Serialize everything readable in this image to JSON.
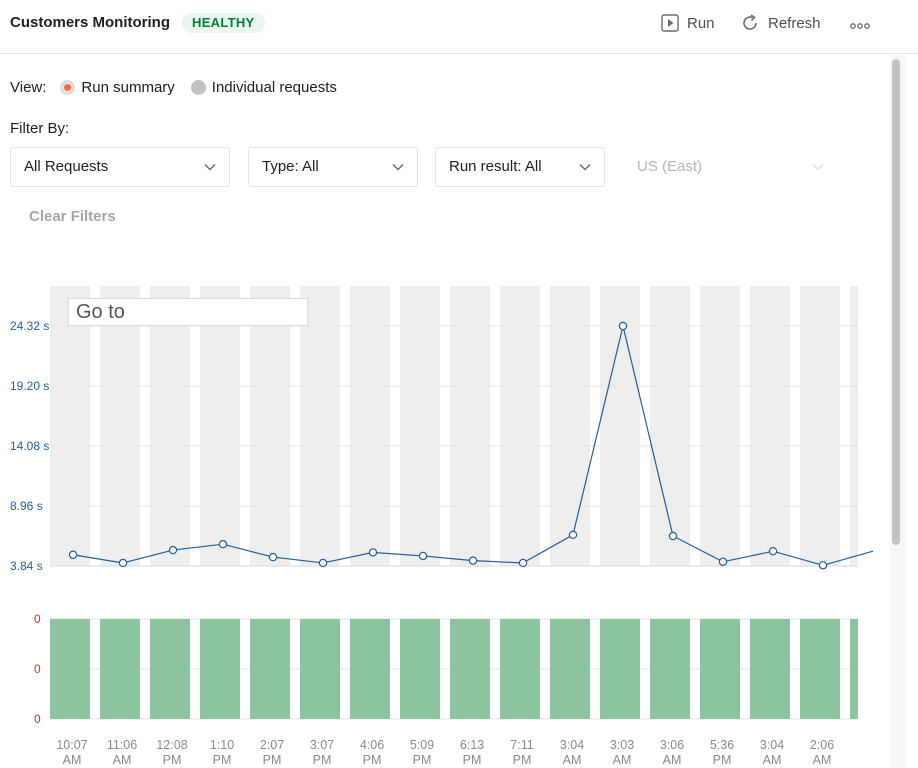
{
  "header": {
    "title": "Customers Monitoring",
    "status_badge": "HEALTHY",
    "run_label": "Run",
    "refresh_label": "Refresh"
  },
  "view": {
    "label": "View:",
    "options": [
      {
        "label": "Run summary",
        "selected": true
      },
      {
        "label": "Individual requests",
        "selected": false
      }
    ]
  },
  "filters": {
    "label": "Filter By:",
    "requests": "All Requests",
    "type": "Type: All",
    "run_result": "Run result: All",
    "region": "US (East)",
    "clear_label": "Clear Filters"
  },
  "goto_placeholder": "Go to",
  "colors": {
    "accent": "#ff6c37",
    "healthy": "#007f31",
    "line": "#1f5f99",
    "bar": "#8bc49e",
    "column_bg": "#eeeeee"
  },
  "chart_data": {
    "type": "line",
    "y_ticks": [
      "24.32 s",
      "19.20 s",
      "14.08 s",
      "8.96 s",
      "3.84 s"
    ],
    "ylim": [
      3.84,
      24.32
    ],
    "x_labels": [
      [
        "10:07",
        "AM"
      ],
      [
        "11:06",
        "AM"
      ],
      [
        "12:08",
        "PM"
      ],
      [
        "1:10",
        "PM"
      ],
      [
        "2:07",
        "PM"
      ],
      [
        "3:07",
        "PM"
      ],
      [
        "4:06",
        "PM"
      ],
      [
        "5:09",
        "PM"
      ],
      [
        "6:13",
        "PM"
      ],
      [
        "7:11",
        "PM"
      ],
      [
        "3:04",
        "AM"
      ],
      [
        "3:03",
        "AM"
      ],
      [
        "3:06",
        "AM"
      ],
      [
        "5:36",
        "PM"
      ],
      [
        "3:04",
        "AM"
      ],
      [
        "2:06",
        "AM"
      ]
    ],
    "values": [
      4.8,
      4.1,
      5.2,
      5.7,
      4.6,
      4.1,
      5.0,
      4.7,
      4.3,
      4.1,
      6.5,
      24.32,
      6.4,
      4.2,
      5.1,
      3.9,
      5.1
    ],
    "bar_chart": {
      "type": "bar",
      "y_ticks": [
        "0",
        "0",
        "0"
      ],
      "values": [
        1,
        1,
        1,
        1,
        1,
        1,
        1,
        1,
        1,
        1,
        1,
        1,
        1,
        1,
        1,
        1,
        1
      ]
    }
  }
}
